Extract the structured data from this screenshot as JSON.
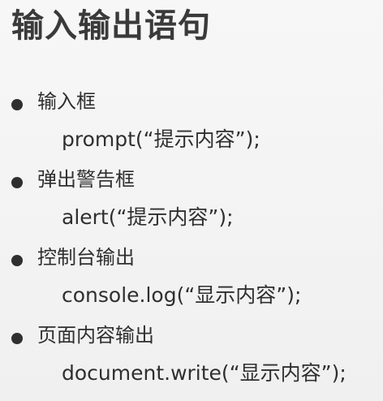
{
  "page": {
    "title": "输入输出语句"
  },
  "items": [
    {
      "label": "输入框",
      "code": "prompt(“提示内容”);"
    },
    {
      "label": "弹出警告框",
      "code": "alert(“提示内容”);"
    },
    {
      "label": "控制台输出",
      "code": "console.log(“显示内容”);"
    },
    {
      "label": "页面内容输出",
      "code": "document.write(“显示内容”);"
    }
  ]
}
